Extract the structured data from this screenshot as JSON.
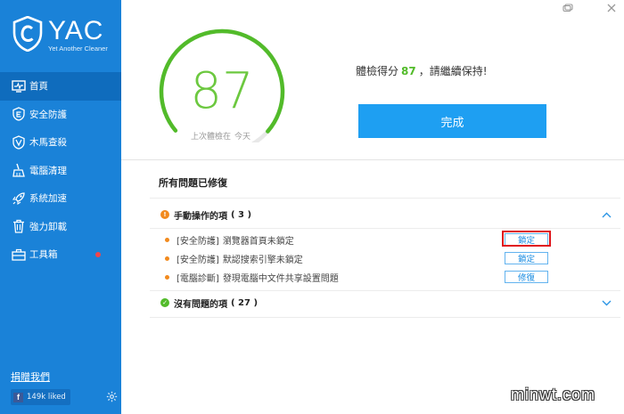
{
  "app": {
    "logo_title": "YAC",
    "logo_subtitle": "Yet Another Cleaner"
  },
  "sidebar": {
    "items": [
      {
        "label": "首頁",
        "icon": "monitor-pulse-icon",
        "active": true
      },
      {
        "label": "安全防護",
        "icon": "shield-e-icon"
      },
      {
        "label": "木馬查殺",
        "icon": "shield-v-icon"
      },
      {
        "label": "電腦清理",
        "icon": "broom-icon"
      },
      {
        "label": "系統加速",
        "icon": "rocket-icon"
      },
      {
        "label": "強力卸載",
        "icon": "trash-icon"
      },
      {
        "label": "工具箱",
        "icon": "toolbox-icon",
        "badge": "red-dot"
      }
    ],
    "donate_label": "捐贈我們",
    "fb_label": "149k liked",
    "fb_icon": "facebook-icon",
    "settings_icon": "gear-icon"
  },
  "window_controls": [
    "skin-icon",
    "close-icon"
  ],
  "score": {
    "value": "87",
    "caption_prefix": "上次體檢在",
    "caption_when": "今天",
    "gauge_fraction": 0.87,
    "color": "#52bb2a"
  },
  "result": {
    "prefix": "體檢得分",
    "score": "87",
    "suffix": "，請繼續保持!"
  },
  "done_button": "完成",
  "section_title": "所有問題已修復",
  "groups": {
    "manual": {
      "title": "手動操作的項",
      "count": "( 3 )",
      "icon": "warning-circle-icon",
      "issues": [
        {
          "category": "[安全防護]",
          "text": "瀏覽器首頁未鎖定",
          "action": "鎖定"
        },
        {
          "category": "[安全防護]",
          "text": "默認搜索引擎未鎖定",
          "action": "鎖定"
        },
        {
          "category": "[電腦診斷]",
          "text": "發現電腦中文件共享設置問題",
          "action": "修復"
        }
      ]
    },
    "ok": {
      "title": "沒有問題的項",
      "count": "( 27 )",
      "icon": "check-circle-icon"
    }
  },
  "watermark": "minwt.com",
  "colors": {
    "sidebar": "#1a82d8",
    "sidebar_active": "#0f6cbd",
    "primary_button": "#1e9ff2",
    "score_green": "#52bb2a",
    "warning": "#f28a1e",
    "highlight": "#e0151b"
  }
}
